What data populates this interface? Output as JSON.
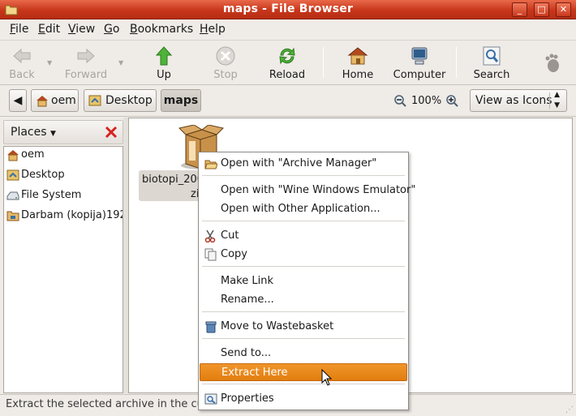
{
  "window": {
    "title": "maps - File Browser",
    "controls": {
      "minimize": "_",
      "maximize": "□",
      "close": "✕"
    }
  },
  "menubar": {
    "items": [
      {
        "label": "File",
        "mnemonic": "F",
        "rest": "ile"
      },
      {
        "label": "Edit",
        "mnemonic": "E",
        "rest": "dit"
      },
      {
        "label": "View",
        "mnemonic": "V",
        "rest": "iew"
      },
      {
        "label": "Go",
        "mnemonic": "G",
        "rest": "o"
      },
      {
        "label": "Bookmarks",
        "mnemonic": "B",
        "rest": "ookmarks"
      },
      {
        "label": "Help",
        "mnemonic": "H",
        "rest": "elp"
      }
    ]
  },
  "toolbar": {
    "back": "Back",
    "forward": "Forward",
    "up": "Up",
    "stop": "Stop",
    "reload": "Reload",
    "home": "Home",
    "computer": "Computer",
    "search": "Search"
  },
  "location": {
    "path": [
      "oem",
      "Desktop",
      "maps"
    ],
    "zoom": "100%",
    "view_mode": "View as Icons"
  },
  "sidebar": {
    "title": "Places",
    "items": [
      {
        "label": "oem",
        "icon": "home-folder-icon"
      },
      {
        "label": "Desktop",
        "icon": "desktop-icon"
      },
      {
        "label": "File System",
        "icon": "drive-icon"
      },
      {
        "label": "Darbam (kopija)192",
        "icon": "network-folder-icon"
      }
    ]
  },
  "main": {
    "file": {
      "name_line1": "biotopi_200",
      "name_line2": "zi",
      "icon": "archive-icon"
    }
  },
  "context_menu": {
    "items": [
      {
        "label": "Open with \"Archive Manager\"",
        "icon": "folder-open-icon"
      },
      {
        "label": "Open with \"Wine Windows Emulator\""
      },
      {
        "label": "Open with Other Application..."
      },
      {
        "label": "Cut",
        "icon": "scissors-icon"
      },
      {
        "label": "Copy",
        "icon": "copy-icon"
      },
      {
        "label": "Make Link"
      },
      {
        "label": "Rename..."
      },
      {
        "label": "Move to Wastebasket",
        "icon": "trash-icon"
      },
      {
        "label": "Send to..."
      },
      {
        "label": "Extract Here",
        "highlighted": true
      },
      {
        "label": "Properties",
        "icon": "properties-icon"
      }
    ]
  },
  "statusbar": {
    "text": "Extract the selected archive in the cu"
  },
  "colors": {
    "titlebar": "#c8361b",
    "highlight": "#e8870f",
    "window_bg": "#efebe7"
  }
}
